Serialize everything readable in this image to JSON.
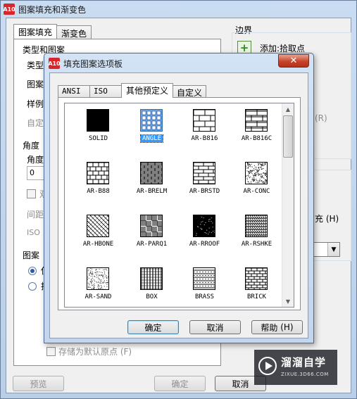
{
  "outer": {
    "title": "图案填充和渐变色",
    "app_icon_text": "A10",
    "tabs": [
      "图案填充",
      "渐变色"
    ],
    "left": {
      "type_pattern": "类型和图案",
      "type": "类型",
      "pattern": "图案",
      "swatch": "样例",
      "custom": "自定",
      "angle_group": "角度",
      "angle": "角度",
      "angle_value": "0",
      "double": "双",
      "spacing": "间距",
      "iso": "ISO",
      "origin_group": "图案",
      "radio1": "使",
      "radio2": "指",
      "store_default": "存储为默认原点",
      "store_default_key": "(F)"
    },
    "right": {
      "border": "边界",
      "add_pick": "添加:拾取点",
      "hatch_fragment": "充",
      "hatch_key": "(H)",
      "r_key": "(R)"
    },
    "buttons": {
      "preview": "预览",
      "ok": "确定",
      "cancel": "取消"
    }
  },
  "dialog": {
    "title": "填充图案选项板",
    "tabs": [
      "ANSI",
      "ISO",
      "其他预定义",
      "自定义"
    ],
    "patterns": [
      "SOLID",
      "ANGLE",
      "AR-B816",
      "AR-B816C",
      "AR-B88",
      "AR-BRELM",
      "AR-BRSTD",
      "AR-CONC",
      "AR-HBONE",
      "AR-PARQ1",
      "AR-RROOF",
      "AR-RSHKE",
      "AR-SAND",
      "BOX",
      "BRASS",
      "BRICK"
    ],
    "selected": "ANGLE",
    "buttons": {
      "ok": "确定",
      "cancel": "取消",
      "help": "帮助",
      "help_key": "(H)"
    }
  },
  "watermark": {
    "brand": "溜溜自学",
    "url": "ZIXUE.3D66.COM"
  }
}
